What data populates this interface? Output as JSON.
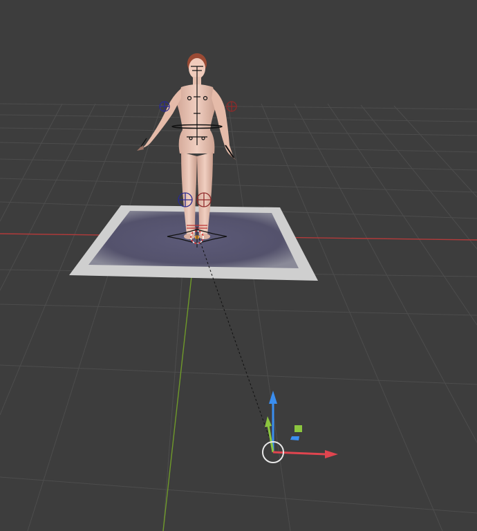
{
  "viewport": {
    "type": "3d-viewport",
    "background_color": "#3d3d3d",
    "grid_color": "#4f4f4f",
    "x_axis_color": "#c43a3a",
    "y_axis_color": "#6f9a2a"
  },
  "scene": {
    "objects": [
      {
        "name": "female-character-mesh",
        "type": "mesh"
      },
      {
        "name": "character-armature",
        "type": "armature",
        "controls": [
          "head",
          "spine",
          "hips",
          "shoulder-l",
          "shoulder-r",
          "hand-l",
          "hand-r",
          "knee-l",
          "knee-r",
          "foot-root"
        ]
      },
      {
        "name": "floor-plane",
        "type": "plane",
        "color": "#d8d8d8",
        "inner_color": "#5a5872"
      },
      {
        "name": "light",
        "type": "light"
      }
    ]
  },
  "gizmo": {
    "z_color": "#3a8ef0",
    "y_color": "#8cc63f",
    "x_color": "#e0454f",
    "plane_xz_color": "#8cc63f",
    "plane_xy_color": "#3a8ef0"
  }
}
